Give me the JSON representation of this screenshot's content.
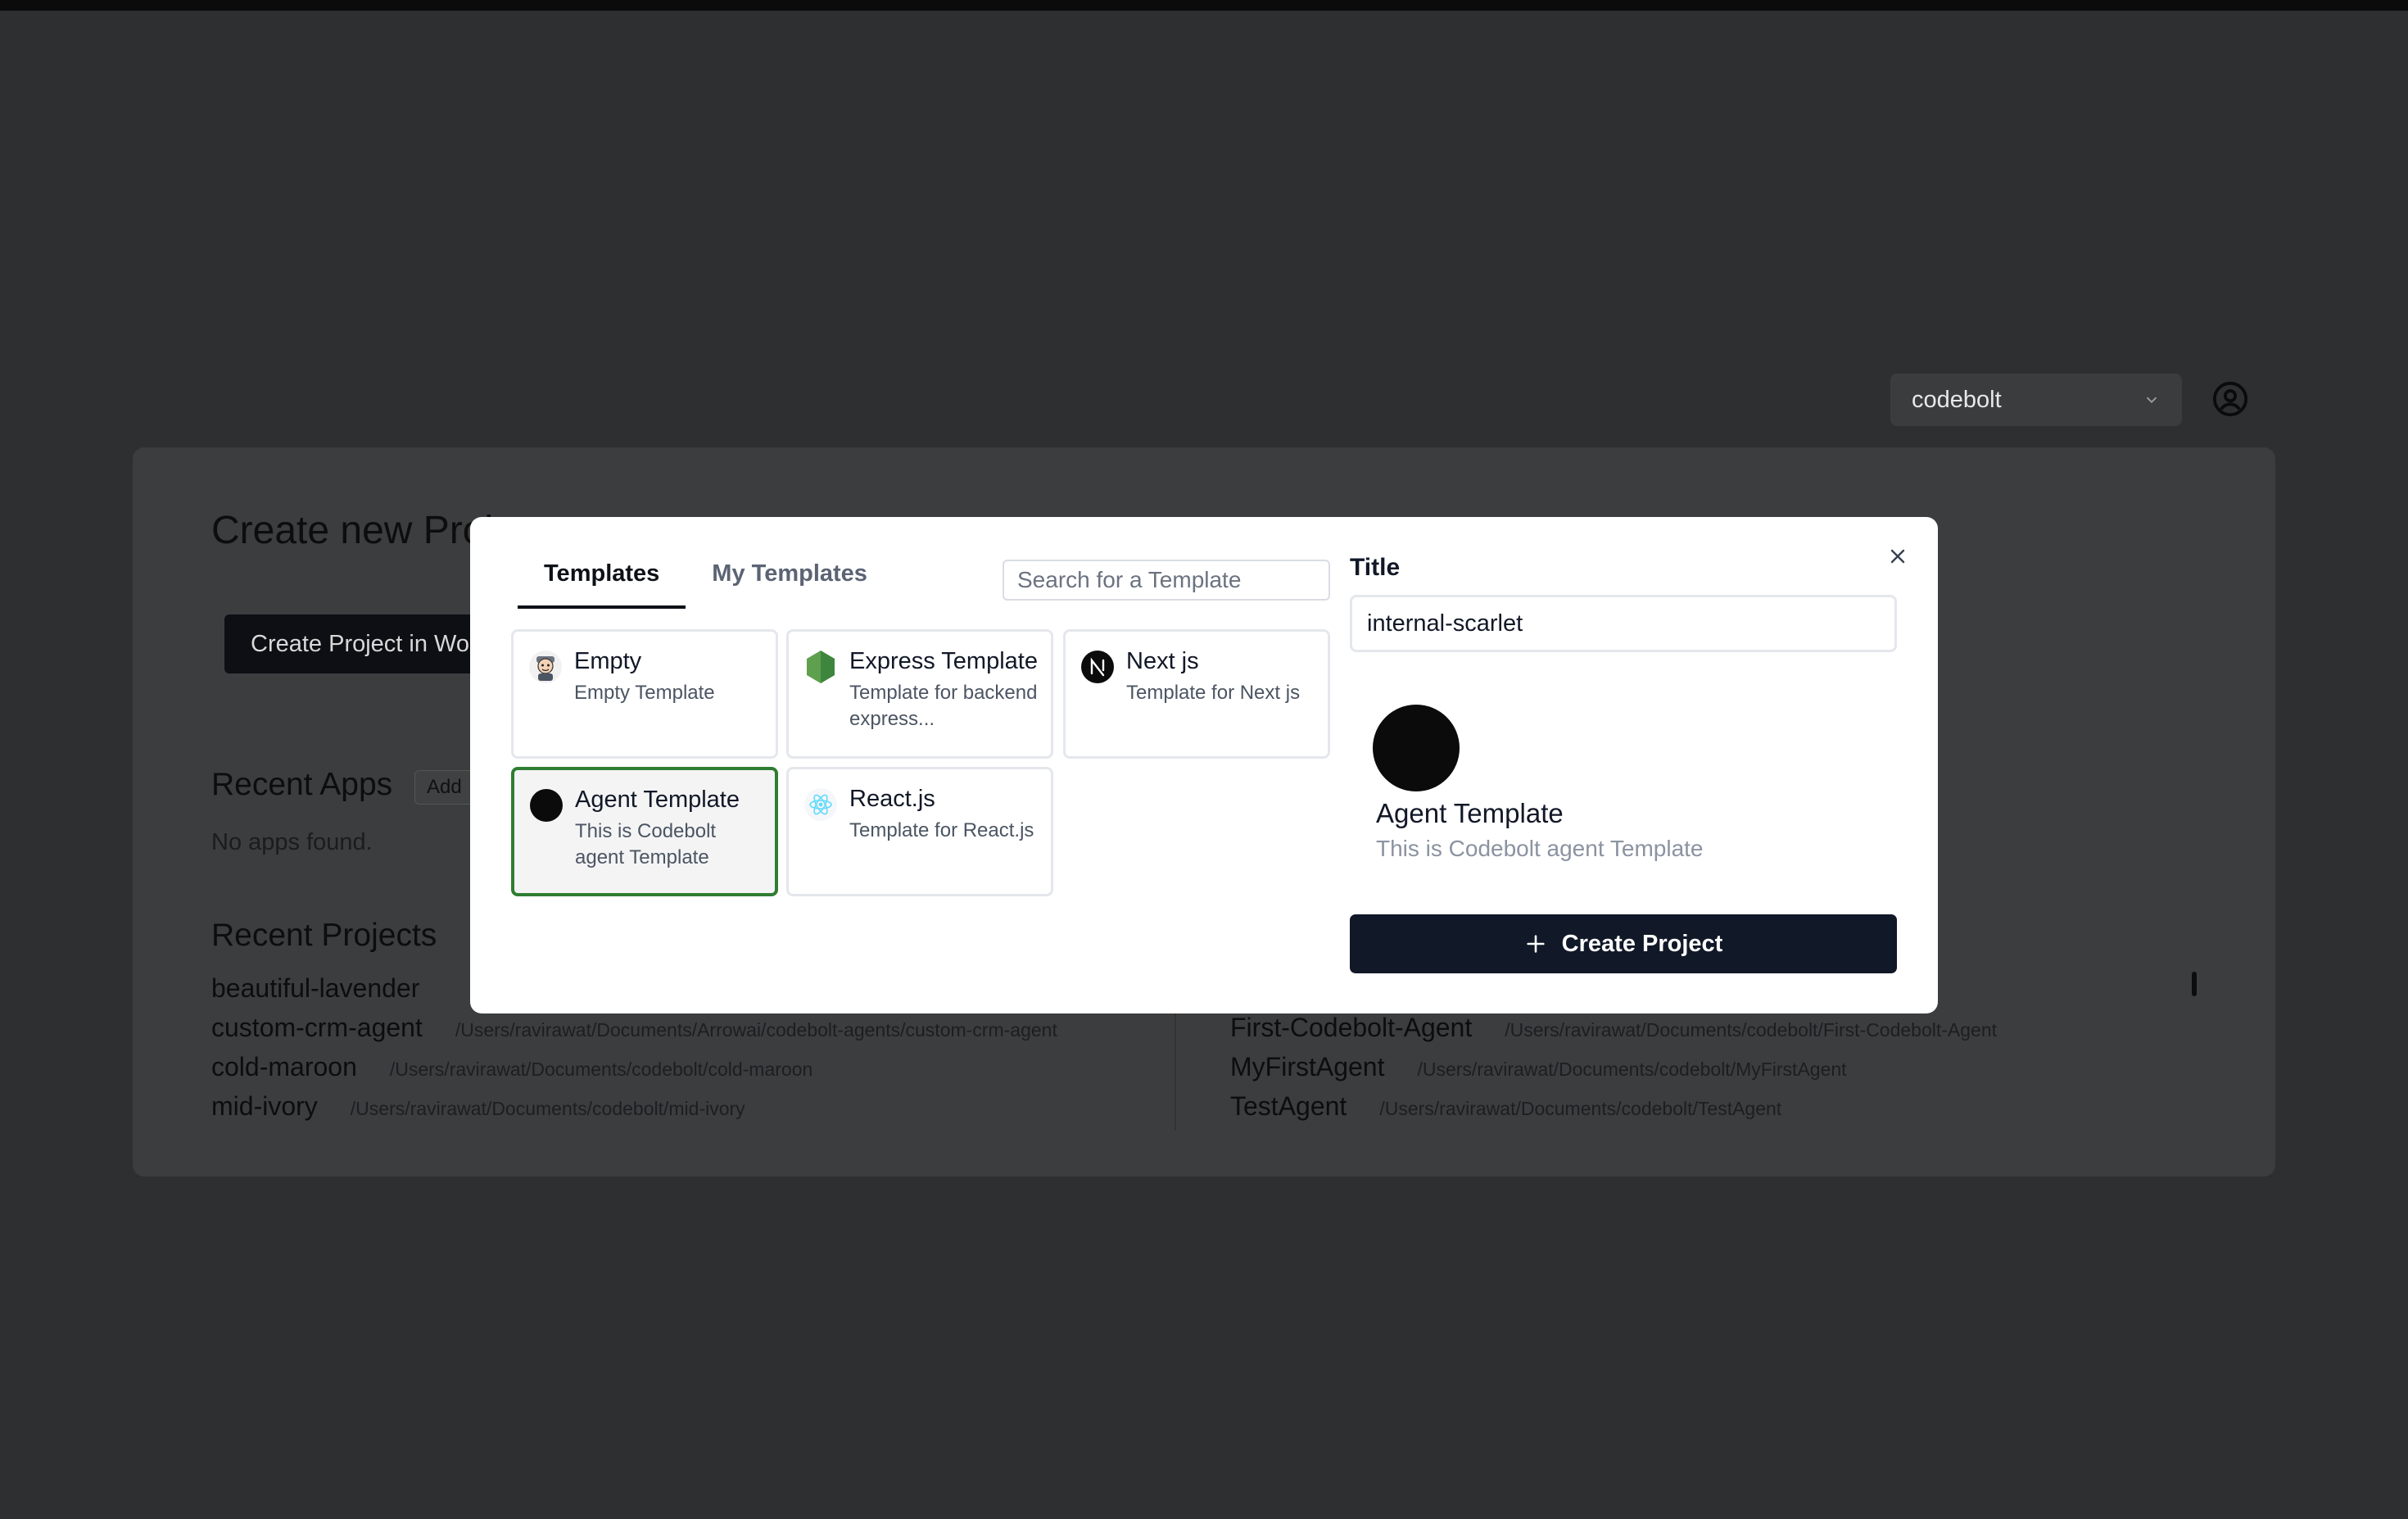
{
  "header": {
    "workspace_select": "codebolt",
    "user_icon": "user-circle-icon"
  },
  "background_page": {
    "title": "Create new Proj",
    "create_in_workspace_button": "Create Project in Wo",
    "recent_apps": {
      "heading": "Recent Apps",
      "add_button": "Add",
      "empty_message": "No apps found."
    },
    "recent_projects": {
      "heading": "Recent Projects",
      "left_column": [
        {
          "name": "beautiful-lavender",
          "path": ""
        },
        {
          "name": "custom-crm-agent",
          "path": "/Users/ravirawat/Documents/Arrowai/codebolt-agents/custom-crm-agent"
        },
        {
          "name": "cold-maroon",
          "path": "/Users/ravirawat/Documents/codebolt/cold-maroon"
        },
        {
          "name": "mid-ivory",
          "path": "/Users/ravirawat/Documents/codebolt/mid-ivory"
        }
      ],
      "right_column": [
        {
          "name": "First-Codebolt-Agent",
          "path": "/Users/ravirawat/Documents/codebolt/First-Codebolt-Agent"
        },
        {
          "name": "MyFirstAgent",
          "path": "/Users/ravirawat/Documents/codebolt/MyFirstAgent"
        },
        {
          "name": "TestAgent",
          "path": "/Users/ravirawat/Documents/codebolt/TestAgent"
        }
      ]
    }
  },
  "modal": {
    "tabs": [
      {
        "label": "Templates",
        "active": true
      },
      {
        "label": "My Templates",
        "active": false
      }
    ],
    "search_placeholder": "Search for a Template",
    "templates": [
      {
        "name": "Empty",
        "description": "Empty Template",
        "icon": "codebolt-mascot-icon",
        "selected": false
      },
      {
        "name": "Express Template",
        "description": "Template for backend express...",
        "icon": "nodejs-hexagon-icon",
        "selected": false
      },
      {
        "name": "Next js",
        "description": "Template for Next js",
        "icon": "nextjs-icon",
        "selected": false
      },
      {
        "name": "Agent Template",
        "description": "This is Codebolt agent Template",
        "icon": "agent-dot-icon",
        "selected": true
      },
      {
        "name": "React.js",
        "description": "Template for React.js",
        "icon": "react-atom-icon",
        "selected": false
      }
    ],
    "title_label": "Title",
    "title_value": "internal-scarlet",
    "preview": {
      "name": "Agent Template",
      "description": "This is Codebolt agent Template"
    },
    "create_button": "Create Project",
    "close_icon": "close-icon"
  },
  "colors": {
    "overlay_bg": "#2d2f31",
    "modal_bg": "#ffffff",
    "primary_button": "#111827",
    "selected_border": "#2f7d32"
  }
}
